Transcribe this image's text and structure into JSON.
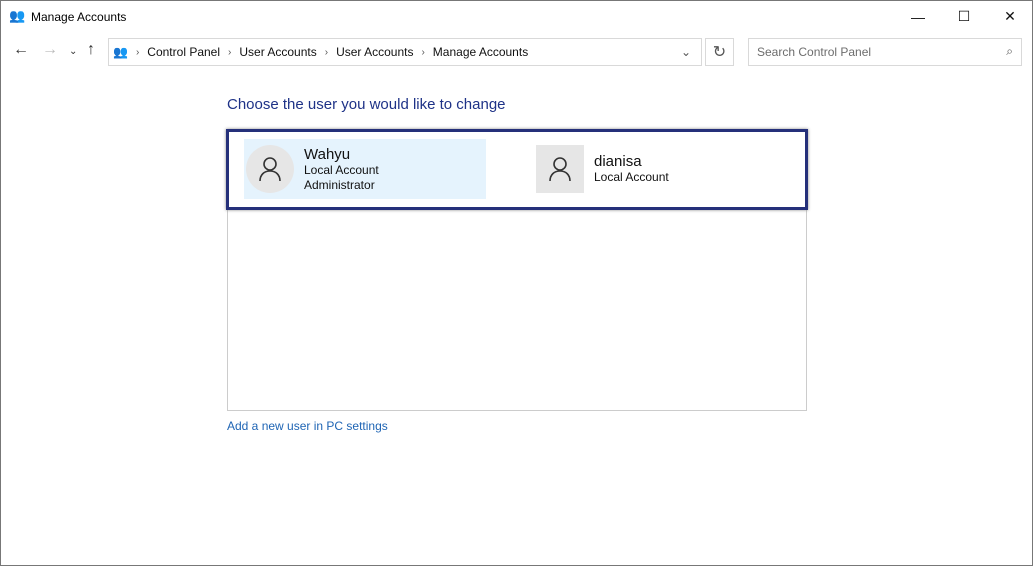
{
  "window": {
    "title": "Manage Accounts"
  },
  "breadcrumb": [
    "Control Panel",
    "User Accounts",
    "User Accounts",
    "Manage Accounts"
  ],
  "search": {
    "placeholder": "Search Control Panel"
  },
  "heading": "Choose the user you would like to change",
  "accounts": [
    {
      "name": "Wahyu",
      "type": "Local Account",
      "role": "Administrator",
      "selected": true
    },
    {
      "name": "dianisa",
      "type": "Local Account",
      "role": ""
    }
  ],
  "add_user_link": "Add a new user in PC settings",
  "colors": {
    "heading": "#1e3287",
    "link": "#1e64b4",
    "selected_bg": "#e5f3fd",
    "highlight_border": "#25307a"
  }
}
